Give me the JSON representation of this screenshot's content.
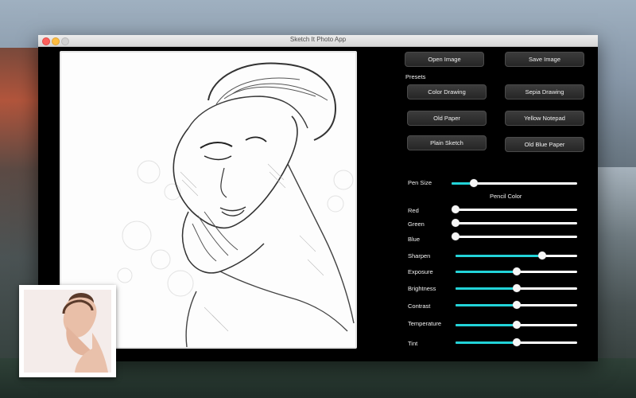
{
  "window": {
    "title": "Sketch It Photo App"
  },
  "buttons": {
    "open_image": "Open Image",
    "save_image": "Save Image"
  },
  "presets": {
    "heading": "Presets",
    "items": [
      {
        "label": "Color Drawing",
        "name": "color-drawing-button"
      },
      {
        "label": "Sepia Drawing",
        "name": "sepia-drawing-button"
      },
      {
        "label": "Old Paper",
        "name": "old-paper-button"
      },
      {
        "label": "Yellow Notepad",
        "name": "yellow-notepad-button"
      },
      {
        "label": "Plain Sketch",
        "name": "plain-sketch-button"
      },
      {
        "label": "Old Blue Paper",
        "name": "old-blue-paper-button"
      }
    ]
  },
  "pencil_color": {
    "heading": "Pencil Color"
  },
  "sliders": {
    "pen_size": {
      "label": "Pen Size",
      "value": 0.18,
      "filled": true
    },
    "red": {
      "label": "Red",
      "value": 0.0,
      "filled": false
    },
    "green": {
      "label": "Green",
      "value": 0.0,
      "filled": false
    },
    "blue": {
      "label": "Blue",
      "value": 0.0,
      "filled": false
    },
    "sharpen": {
      "label": "Sharpen",
      "value": 0.71,
      "filled": true
    },
    "exposure": {
      "label": "Exposure",
      "value": 0.5,
      "filled": true
    },
    "brightness": {
      "label": "Brightness",
      "value": 0.5,
      "filled": true
    },
    "contrast": {
      "label": "Contrast",
      "value": 0.5,
      "filled": true
    },
    "temperature": {
      "label": "Temperature",
      "value": 0.5,
      "filled": true
    },
    "tint": {
      "label": "Tint",
      "value": 0.5,
      "filled": true
    }
  },
  "colors": {
    "accent": "#22d3d8",
    "panel_bg": "#000000",
    "button_bg": "#2f2f2f"
  },
  "icons": {
    "close": "close-icon",
    "minimize": "minimize-icon",
    "maximize": "maximize-icon"
  }
}
